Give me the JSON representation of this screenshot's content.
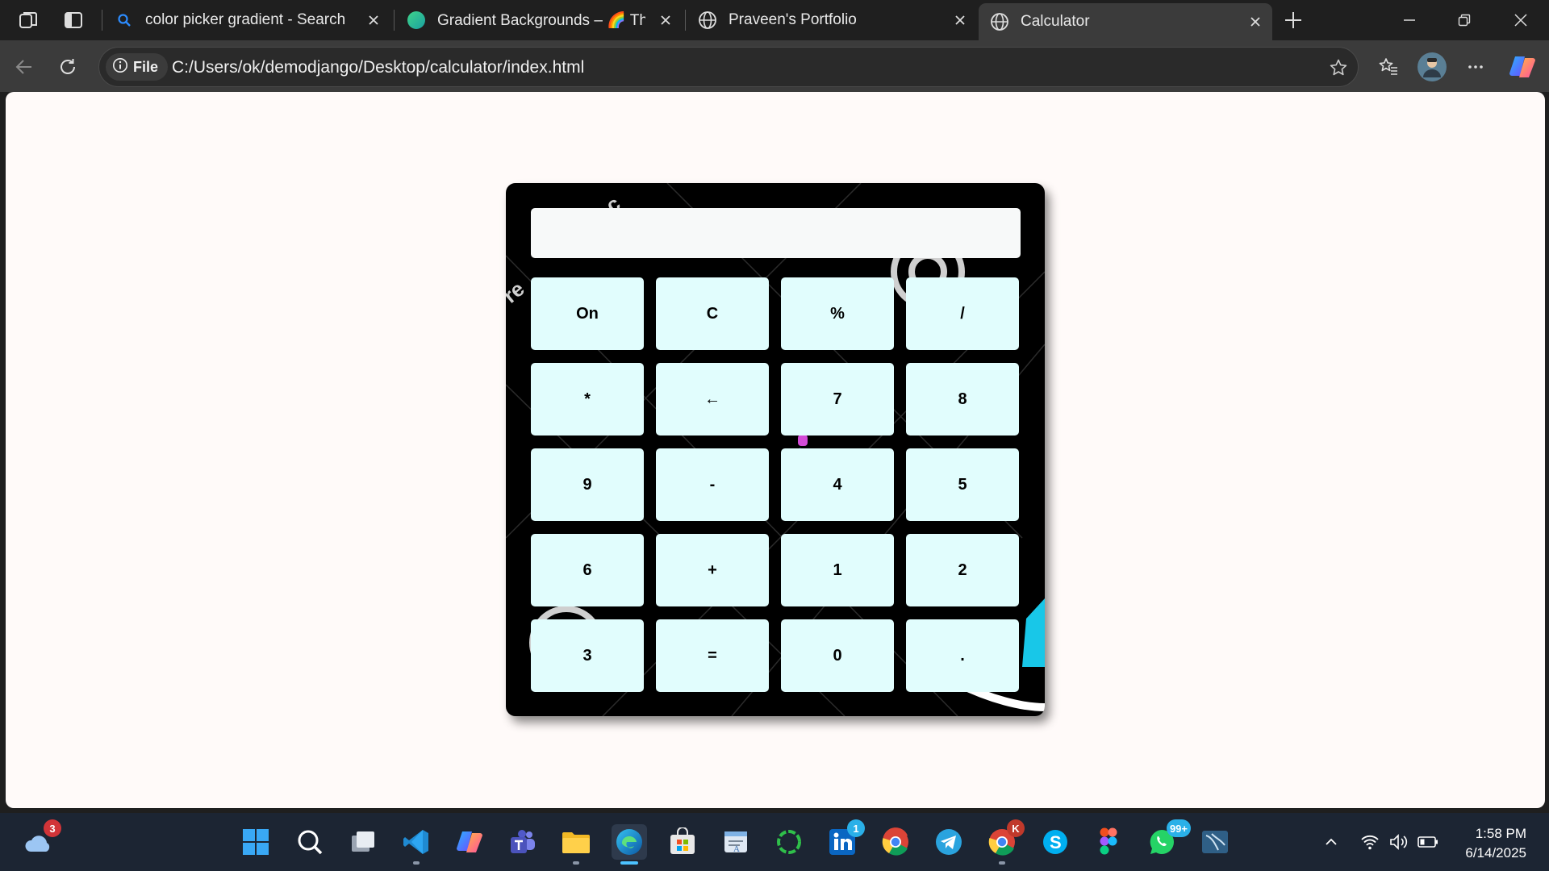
{
  "browser": {
    "tabs": [
      {
        "title": "color picker gradient - Search",
        "favicon": "search-icon"
      },
      {
        "title": "Gradient Backgrounds – 🌈 The Best Gradient Colors",
        "favicon": "green-circle-icon"
      },
      {
        "title": "Praveen's Portfolio",
        "favicon": "globe-icon"
      },
      {
        "title": "Calculator",
        "favicon": "globe-icon",
        "active": true
      }
    ],
    "address": {
      "scheme_label": "File",
      "url": "C:/Users/ok/demodjango/Desktop/calculator/index.html"
    }
  },
  "calculator": {
    "display_value": "",
    "keys": [
      "On",
      "C",
      "%",
      "/",
      "*",
      "←",
      "7",
      "8",
      "9",
      "-",
      "4",
      "5",
      "6",
      "+",
      "1",
      "2",
      "3",
      "=",
      "0",
      "."
    ]
  },
  "taskbar": {
    "weather_badge": "3",
    "linkedin_badge": "1",
    "chrome_profile_badge": "K",
    "whatsapp_badge": "99+",
    "time": "1:58 PM",
    "date": "6/14/2025"
  },
  "colors": {
    "page_background": "#fffaf9",
    "calculator_body": "#000000",
    "key_background": "#e1fdfd",
    "display_background": "#f7f9f9",
    "taskbar": "#1c2533"
  }
}
